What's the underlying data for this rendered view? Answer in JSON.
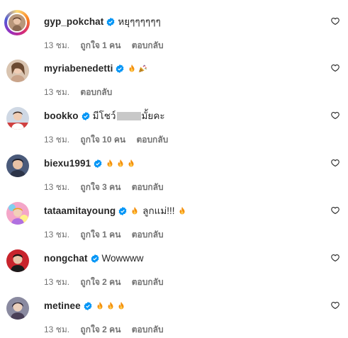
{
  "comments": [
    {
      "username": "gyp_pokchat",
      "text": "หยุๆๆๆๆๆๆ",
      "emojis": [],
      "time": "13 ชม.",
      "likes": "ถูกใจ 1 คน",
      "reply": "ตอบกลับ"
    },
    {
      "username": "myriabenedetti",
      "text": "",
      "emojis": [
        "fire-emoji",
        "party-popper-emoji"
      ],
      "time": "13 ชม.",
      "likes": "",
      "reply": "ตอบกลับ"
    },
    {
      "username": "bookko",
      "text_before": "มีโชว์",
      "text_after": "มั้ยคะ",
      "emojis": [],
      "time": "13 ชม.",
      "likes": "ถูกใจ 10 คน",
      "reply": "ตอบกลับ"
    },
    {
      "username": "biexu1991",
      "text": "",
      "emojis": [
        "fire-emoji",
        "fire-emoji",
        "fire-emoji"
      ],
      "time": "13 ชม.",
      "likes": "ถูกใจ 3 คน",
      "reply": "ตอบกลับ"
    },
    {
      "username": "tataamitayoung",
      "text": "ลูกแม่!!!",
      "emojis": [
        "fire-emoji"
      ],
      "trailing_emojis": [
        "fire-emoji"
      ],
      "time": "13 ชม.",
      "likes": "ถูกใจ 1 คน",
      "reply": "ตอบกลับ"
    },
    {
      "username": "nongchat",
      "text": "Wowwww",
      "emojis": [],
      "time": "13 ชม.",
      "likes": "ถูกใจ 2 คน",
      "reply": "ตอบกลับ"
    },
    {
      "username": "metinee",
      "text": "",
      "emojis": [
        "fire-emoji",
        "fire-emoji",
        "fire-emoji"
      ],
      "time": "13 ชม.",
      "likes": "ถูกใจ 2 คน",
      "reply": "ตอบกลับ"
    }
  ],
  "colors": {
    "text": "#262626",
    "secondary": "#737373",
    "verified": "#0095f6"
  }
}
